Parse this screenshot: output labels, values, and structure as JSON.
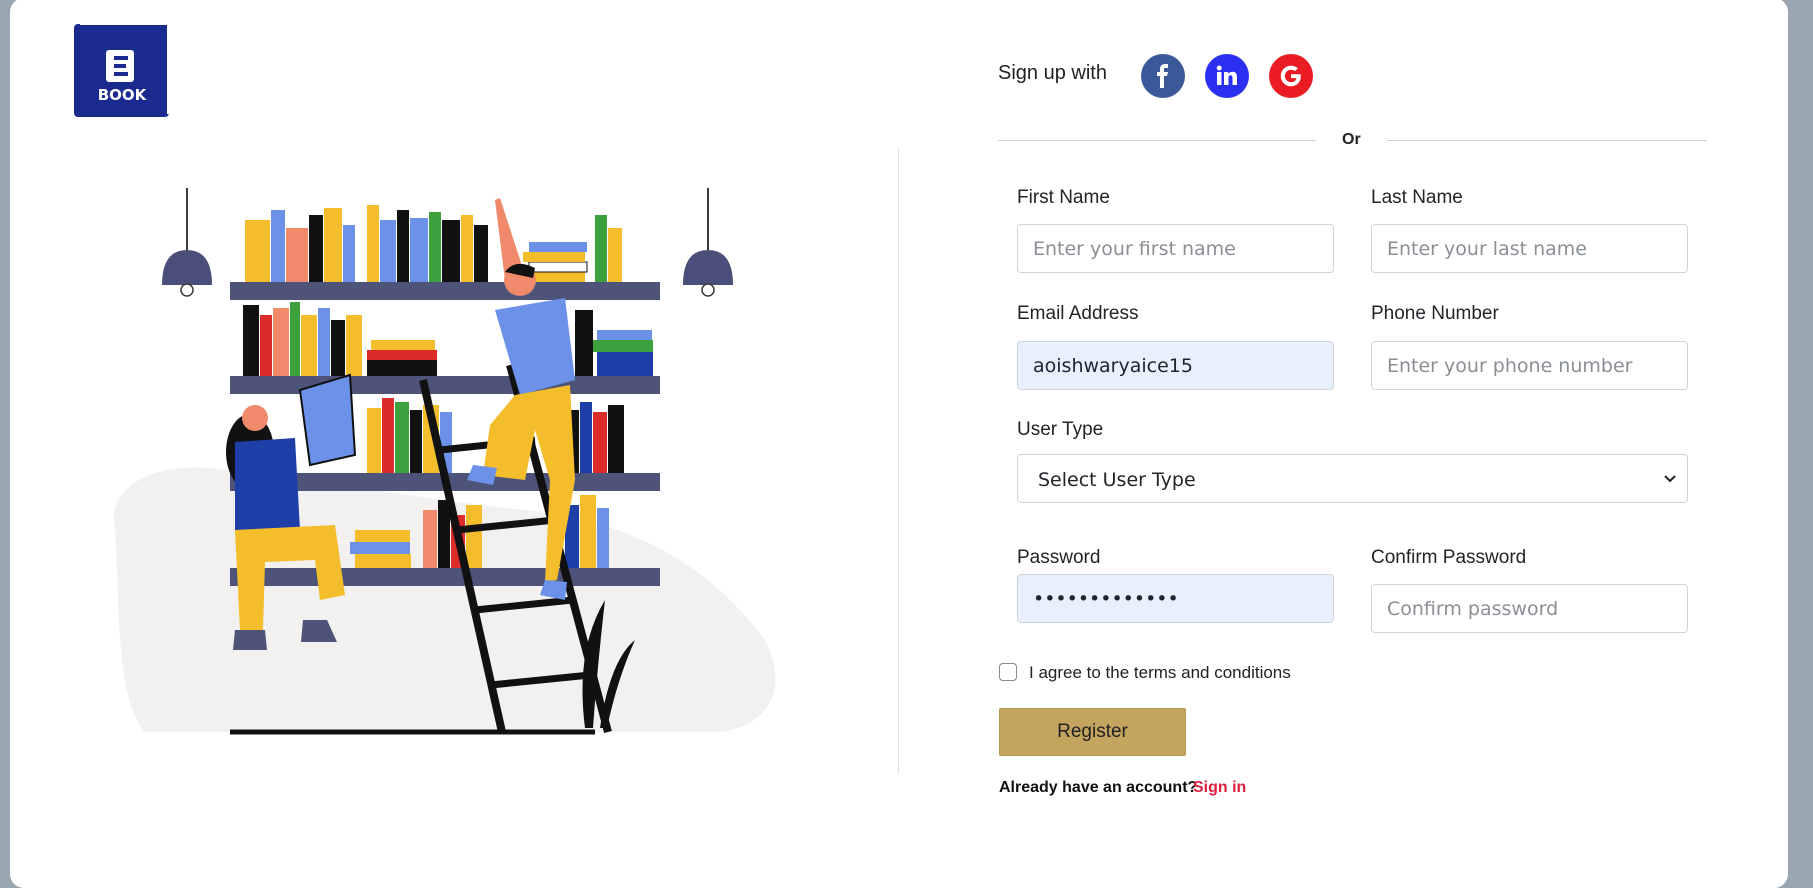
{
  "brand": {
    "logo_line1": "E",
    "logo_line2": "BOOK",
    "color": "#1b2a8f"
  },
  "social": {
    "title": "Sign up with",
    "facebook": {
      "icon": "facebook-icon",
      "color": "#3b5998"
    },
    "linkedin": {
      "icon": "linkedin-icon",
      "color": "#2a2ff0"
    },
    "google": {
      "icon": "google-icon",
      "color": "#ea1c24"
    }
  },
  "separator": "Or",
  "form": {
    "first_name": {
      "label": "First Name",
      "placeholder": "Enter your first name",
      "value": ""
    },
    "last_name": {
      "label": "Last Name",
      "placeholder": "Enter your last name",
      "value": ""
    },
    "email": {
      "label": "Email Address",
      "placeholder": "",
      "value": "aoishwaryaice15"
    },
    "phone": {
      "label": "Phone Number",
      "placeholder": "Enter your phone number",
      "value": ""
    },
    "user_type": {
      "label": "User Type",
      "selected": "Select User Type"
    },
    "password": {
      "label": "Password",
      "value": "•••••••••••••"
    },
    "confirm_password": {
      "label": "Confirm Password",
      "placeholder": "Confirm password",
      "value": ""
    },
    "terms": "I agree to the terms and conditions",
    "submit": "Register"
  },
  "footer": {
    "question": "Already have an account?",
    "link": "Sign in"
  },
  "colors": {
    "accent": "#c4a55f",
    "link": "#dc1f3c",
    "autofill": "#e8f0fe"
  }
}
